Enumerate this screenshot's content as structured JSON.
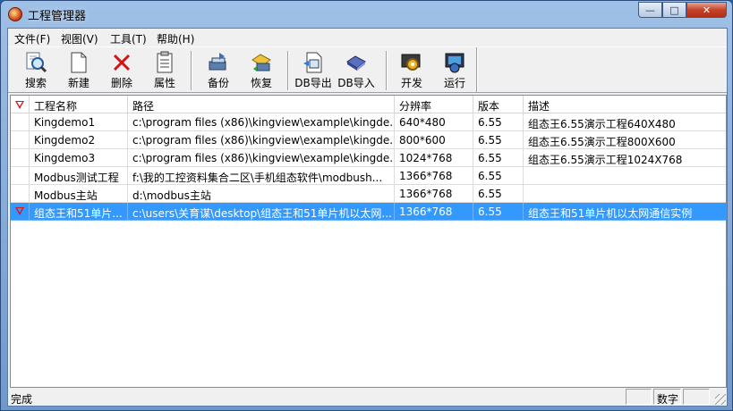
{
  "window": {
    "title": "工程管理器",
    "minimize_label": "—",
    "maximize_label": "□",
    "close_label": "✕"
  },
  "menu": [
    {
      "label": "文件(F)"
    },
    {
      "label": "视图(V)"
    },
    {
      "label": "工具(T)"
    },
    {
      "label": "帮助(H)"
    }
  ],
  "toolbar": [
    {
      "label": "搜索",
      "icon": "search-icon"
    },
    {
      "label": "新建",
      "icon": "new-file-icon"
    },
    {
      "label": "删除",
      "icon": "delete-x-icon"
    },
    {
      "label": "属性",
      "icon": "properties-icon"
    },
    {
      "label": "备份",
      "icon": "backup-icon"
    },
    {
      "label": "恢复",
      "icon": "restore-icon"
    },
    {
      "label": "DB导出",
      "icon": "db-export-icon"
    },
    {
      "label": "DB导入",
      "icon": "db-import-icon"
    },
    {
      "label": "开发",
      "icon": "develop-icon"
    },
    {
      "label": "运行",
      "icon": "run-icon"
    }
  ],
  "table": {
    "columns": [
      "工程名称",
      "路径",
      "分辨率",
      "版本",
      "描述"
    ],
    "rows": [
      {
        "name": "Kingdemo1",
        "path": "c:\\program files (x86)\\kingview\\example\\kingde...",
        "resolution": "640*480",
        "version": "6.55",
        "desc": "组态王6.55演示工程640X480",
        "selected": false,
        "flag": false
      },
      {
        "name": "Kingdemo2",
        "path": "c:\\program files (x86)\\kingview\\example\\kingde...",
        "resolution": "800*600",
        "version": "6.55",
        "desc": "组态王6.55演示工程800X600",
        "selected": false,
        "flag": false
      },
      {
        "name": "Kingdemo3",
        "path": "c:\\program files (x86)\\kingview\\example\\kingde...",
        "resolution": "1024*768",
        "version": "6.55",
        "desc": "组态王6.55演示工程1024X768",
        "selected": false,
        "flag": false
      },
      {
        "name": "Modbus测试工程",
        "path": "f:\\我的工控资料集合二区\\手机组态软件\\modbush...",
        "resolution": "1366*768",
        "version": "6.55",
        "desc": "",
        "selected": false,
        "flag": false
      },
      {
        "name": "Modbus主站",
        "path": "d:\\modbus主站",
        "resolution": "1366*768",
        "version": "6.55",
        "desc": "",
        "selected": false,
        "flag": false
      },
      {
        "name": "组态王和51单片...",
        "path": "c:\\users\\关育谋\\desktop\\组态王和51单片机以太网...",
        "resolution": "1366*768",
        "version": "6.55",
        "desc": "组态王和51单片机以太网通信实例",
        "selected": true,
        "flag": true
      }
    ]
  },
  "status": {
    "text": "完成",
    "pane_numlock": "数字"
  },
  "colors": {
    "selection": "#3399ff",
    "flag": "#d01818"
  }
}
